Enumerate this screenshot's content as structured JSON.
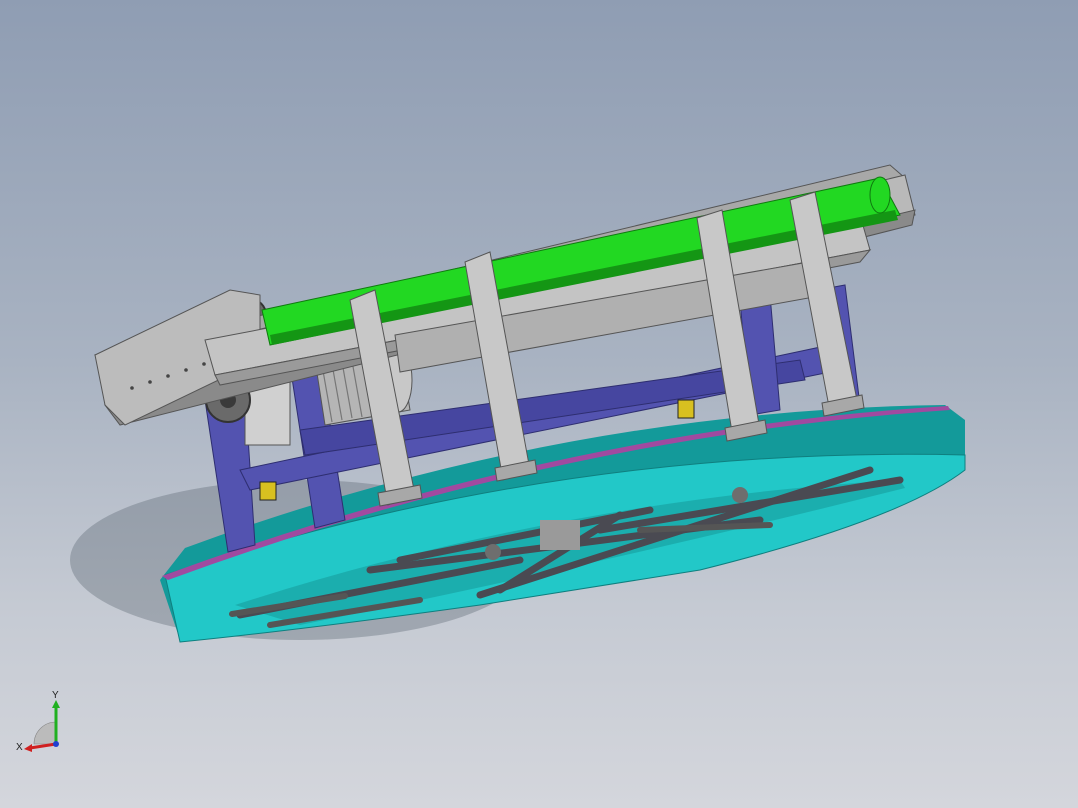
{
  "viewport": {
    "background_top": "#8f9db3",
    "background_bottom": "#d4d6dc"
  },
  "model": {
    "colors": {
      "belt": "#22d822",
      "belt_shadow": "#149614",
      "frame_steel": "#b9b9b9",
      "frame_steel_dark": "#8a8a8a",
      "support_frame": "#5353b0",
      "support_frame_dark": "#3a3a8a",
      "turntable_ring": "#22c8c8",
      "turntable_ring_dark": "#139a9a",
      "turntable_trim": "#a04aa0",
      "bracket_yellow": "#d8c020",
      "dark_parts": "#4a4a52"
    }
  },
  "triad": {
    "x_label": "X",
    "y_label": "Y",
    "x_color": "#d02020",
    "y_color": "#20b020",
    "z_color": "#2040d0"
  }
}
